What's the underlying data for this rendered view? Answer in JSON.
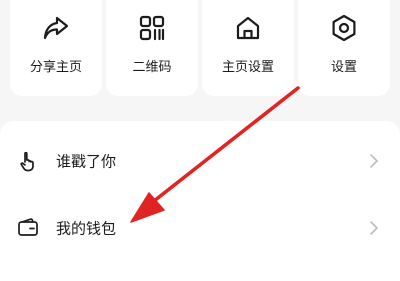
{
  "quick_actions": [
    {
      "label": "分享主页",
      "icon": "share-icon"
    },
    {
      "label": "二维码",
      "icon": "qr-code-icon"
    },
    {
      "label": "主页设置",
      "icon": "home-icon"
    },
    {
      "label": "设置",
      "icon": "gear-icon"
    }
  ],
  "menu": {
    "items": [
      {
        "label": "谁戳了你",
        "icon": "poke-hand-icon"
      },
      {
        "label": "我的钱包",
        "icon": "wallet-icon"
      }
    ]
  },
  "annotation": {
    "type": "arrow",
    "color": "#e02424",
    "points_to": "我的钱包"
  },
  "colors": {
    "background": "#f6f6f6",
    "card": "#ffffff",
    "text": "#1c1c1c",
    "chevron": "#bdbdbd"
  }
}
